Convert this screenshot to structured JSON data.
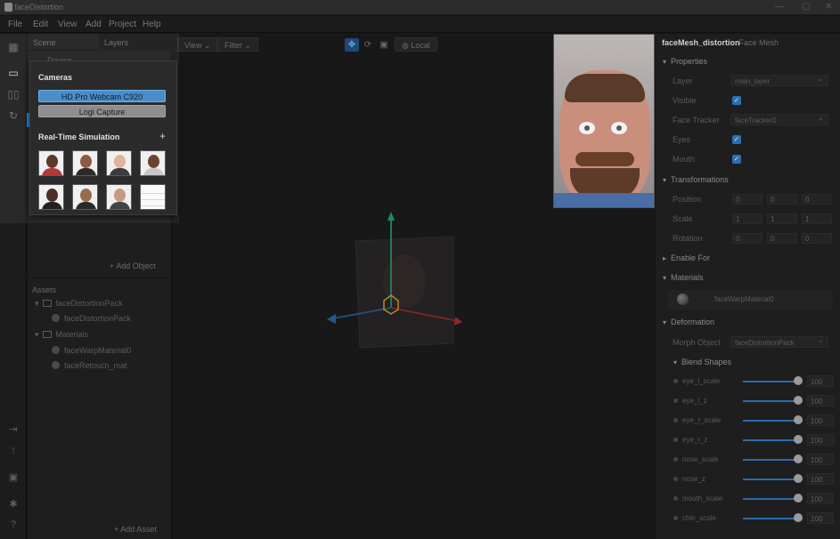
{
  "window": {
    "title": "faceDistortion",
    "controls": [
      "—",
      "▢",
      "✕"
    ]
  },
  "menu": [
    "File",
    "Edit",
    "View",
    "Add",
    "Project",
    "Help"
  ],
  "scene": {
    "tab_scene": "Scene",
    "tab_layers": "Layers",
    "device": "Device",
    "add_object": "+ Add Object"
  },
  "assets": {
    "title": "Assets",
    "items": [
      {
        "label": "faceDistortionPack"
      },
      {
        "label": "faceDistortionPack"
      },
      {
        "label": "Materials"
      },
      {
        "label": "faceWarpMaterial0"
      },
      {
        "label": "faceRetouch_mat"
      }
    ],
    "add_asset": "+ Add Asset"
  },
  "popover": {
    "cameras_title": "Cameras",
    "cameras": [
      {
        "label": "HD Pro Webcam C920",
        "selected": true
      },
      {
        "label": "Logi Capture",
        "selected": false
      }
    ],
    "simulation_title": "Real-Time Simulation",
    "simulation_add": "+",
    "thumbs": [
      {
        "skin": "#5b3a2b",
        "shirt": "#b23a3a"
      },
      {
        "skin": "#8d5a42",
        "shirt": "#2a2a2a"
      },
      {
        "skin": "#e0b39c",
        "shirt": "#3c3c3c"
      },
      {
        "skin": "#6b4230",
        "shirt": "#c8c8c8"
      },
      {
        "skin": "#4a2f22",
        "shirt": "#222222"
      },
      {
        "skin": "#9a6a4e",
        "shirt": "#2a2a2a"
      },
      {
        "skin": "#c99882",
        "shirt": "#444444"
      },
      {
        "skin": "grid",
        "shirt": ""
      }
    ]
  },
  "viewport": {
    "view": "View",
    "filter": "Filter",
    "local": "Local",
    "tool_icons": [
      "move-icon",
      "rotate-icon",
      "scale-icon"
    ]
  },
  "properties": {
    "title": "faceMesh_distortion",
    "subtitle": "– Face Mesh",
    "sections": {
      "properties": "Properties",
      "transformations": "Transformations",
      "enable_for": "Enable For",
      "materials": "Materials",
      "deformation": "Deformation",
      "blend_shapes": "Blend Shapes"
    },
    "layer_label": "Layer",
    "layer_value": "main_layer",
    "visible_label": "Visible",
    "face_tracker_label": "Face Tracker",
    "face_tracker_value": "faceTracker0",
    "eyes_label": "Eyes",
    "mouth_label": "Mouth",
    "position_label": "Position",
    "position": [
      "0",
      "0",
      "0"
    ],
    "scale_label": "Scale",
    "scale": [
      "1",
      "1",
      "1"
    ],
    "rotation_label": "Rotation",
    "rotation": [
      "0",
      "0",
      "0"
    ],
    "material_value": "faceWarpMaterial0",
    "morph_label": "Morph Object",
    "morph_value": "faceDistortionPack",
    "blend_shapes": [
      {
        "name": "eye_l_scale",
        "value": "100"
      },
      {
        "name": "eye_l_z",
        "value": "100"
      },
      {
        "name": "eye_r_scale",
        "value": "100"
      },
      {
        "name": "eye_r_z",
        "value": "100"
      },
      {
        "name": "nose_scale",
        "value": "100"
      },
      {
        "name": "nose_z",
        "value": "100"
      },
      {
        "name": "mouth_scale",
        "value": "100"
      },
      {
        "name": "chin_scale",
        "value": "100"
      }
    ]
  },
  "colors": {
    "accent": "#2b7fd4",
    "selected_camera": "#4a8ec9"
  }
}
